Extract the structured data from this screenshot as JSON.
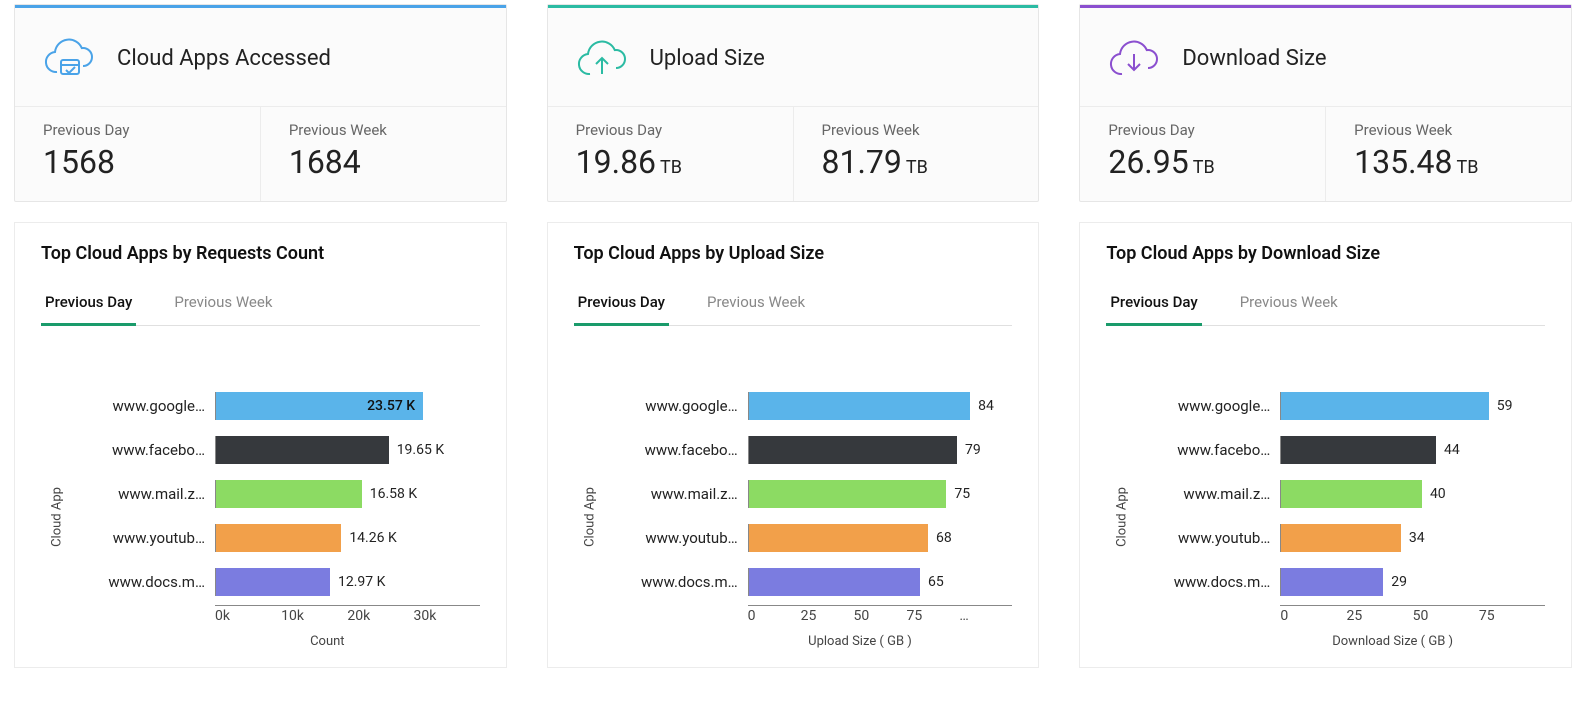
{
  "columns": [
    {
      "accent": "blue",
      "icon": "cloud-apps-icon",
      "iconColor": "#4aa3e8",
      "kpi_title": "Cloud Apps Accessed",
      "stats": [
        {
          "label": "Previous Day",
          "value": "1568",
          "unit": ""
        },
        {
          "label": "Previous Week",
          "value": "1684",
          "unit": ""
        }
      ],
      "chart": {
        "title": "Top Cloud Apps by Requests Count",
        "tabs": [
          "Previous Day",
          "Previous Week"
        ],
        "active_tab": 0,
        "ylabel": "Cloud App",
        "xlabel": "Count",
        "xticks": [
          "0k",
          "10k",
          "20k",
          "30k"
        ],
        "categories": [
          "www.google…",
          "www.facebo…",
          "www.mail.z…",
          "www.youtub…",
          "www.docs.m…"
        ],
        "values": [
          23.57,
          19.65,
          16.58,
          14.26,
          12.97
        ],
        "value_labels": [
          "23.57 K",
          "19.65 K",
          "16.58 K",
          "14.26 K",
          "12.97 K"
        ],
        "max": 30,
        "label_mode": "auto"
      }
    },
    {
      "accent": "teal",
      "icon": "upload-icon",
      "iconColor": "#2bbba3",
      "kpi_title": "Upload Size",
      "stats": [
        {
          "label": "Previous Day",
          "value": "19.86",
          "unit": "TB"
        },
        {
          "label": "Previous Week",
          "value": "81.79",
          "unit": "TB"
        }
      ],
      "chart": {
        "title": "Top Cloud Apps by Upload Size",
        "tabs": [
          "Previous Day",
          "Previous Week"
        ],
        "active_tab": 0,
        "ylabel": "Cloud App",
        "xlabel": "Upload Size ( GB )",
        "xticks": [
          "0",
          "25",
          "50",
          "75",
          "…"
        ],
        "categories": [
          "www.google…",
          "www.facebo…",
          "www.mail.z…",
          "www.youtub…",
          "www.docs.m…"
        ],
        "values": [
          84,
          79,
          75,
          68,
          65
        ],
        "value_labels": [
          "84",
          "79",
          "75",
          "68",
          "65"
        ],
        "max": 100,
        "label_mode": "outside"
      }
    },
    {
      "accent": "purple",
      "icon": "download-icon",
      "iconColor": "#8b4fcf",
      "kpi_title": "Download Size",
      "stats": [
        {
          "label": "Previous Day",
          "value": "26.95",
          "unit": "TB"
        },
        {
          "label": "Previous Week",
          "value": "135.48",
          "unit": "TB"
        }
      ],
      "chart": {
        "title": "Top Cloud Apps by Download Size",
        "tabs": [
          "Previous Day",
          "Previous Week"
        ],
        "active_tab": 0,
        "ylabel": "Cloud App",
        "xlabel": "Download Size ( GB )",
        "xticks": [
          "0",
          "25",
          "50",
          "75"
        ],
        "categories": [
          "www.google…",
          "www.facebo…",
          "www.mail.z…",
          "www.youtub…",
          "www.docs.m…"
        ],
        "values": [
          59,
          44,
          40,
          34,
          29
        ],
        "value_labels": [
          "59",
          "44",
          "40",
          "34",
          "29"
        ],
        "max": 75,
        "label_mode": "outside"
      }
    }
  ],
  "chart_data": [
    {
      "type": "bar",
      "title": "Top Cloud Apps by Requests Count",
      "categories": [
        "www.google…",
        "www.facebo…",
        "www.mail.z…",
        "www.youtub…",
        "www.docs.m…"
      ],
      "values": [
        23570,
        19650,
        16580,
        14260,
        12970
      ],
      "xlabel": "Count",
      "ylabel": "Cloud App",
      "xlim": [
        0,
        30000
      ]
    },
    {
      "type": "bar",
      "title": "Top Cloud Apps by Upload Size",
      "categories": [
        "www.google…",
        "www.facebo…",
        "www.mail.z…",
        "www.youtub…",
        "www.docs.m…"
      ],
      "values": [
        84,
        79,
        75,
        68,
        65
      ],
      "xlabel": "Upload Size ( GB )",
      "ylabel": "Cloud App",
      "xlim": [
        0,
        100
      ]
    },
    {
      "type": "bar",
      "title": "Top Cloud Apps by Download Size",
      "categories": [
        "www.google…",
        "www.facebo…",
        "www.mail.z…",
        "www.youtub…",
        "www.docs.m…"
      ],
      "values": [
        59,
        44,
        40,
        34,
        29
      ],
      "xlabel": "Download Size ( GB )",
      "ylabel": "Cloud App",
      "xlim": [
        0,
        75
      ]
    }
  ]
}
